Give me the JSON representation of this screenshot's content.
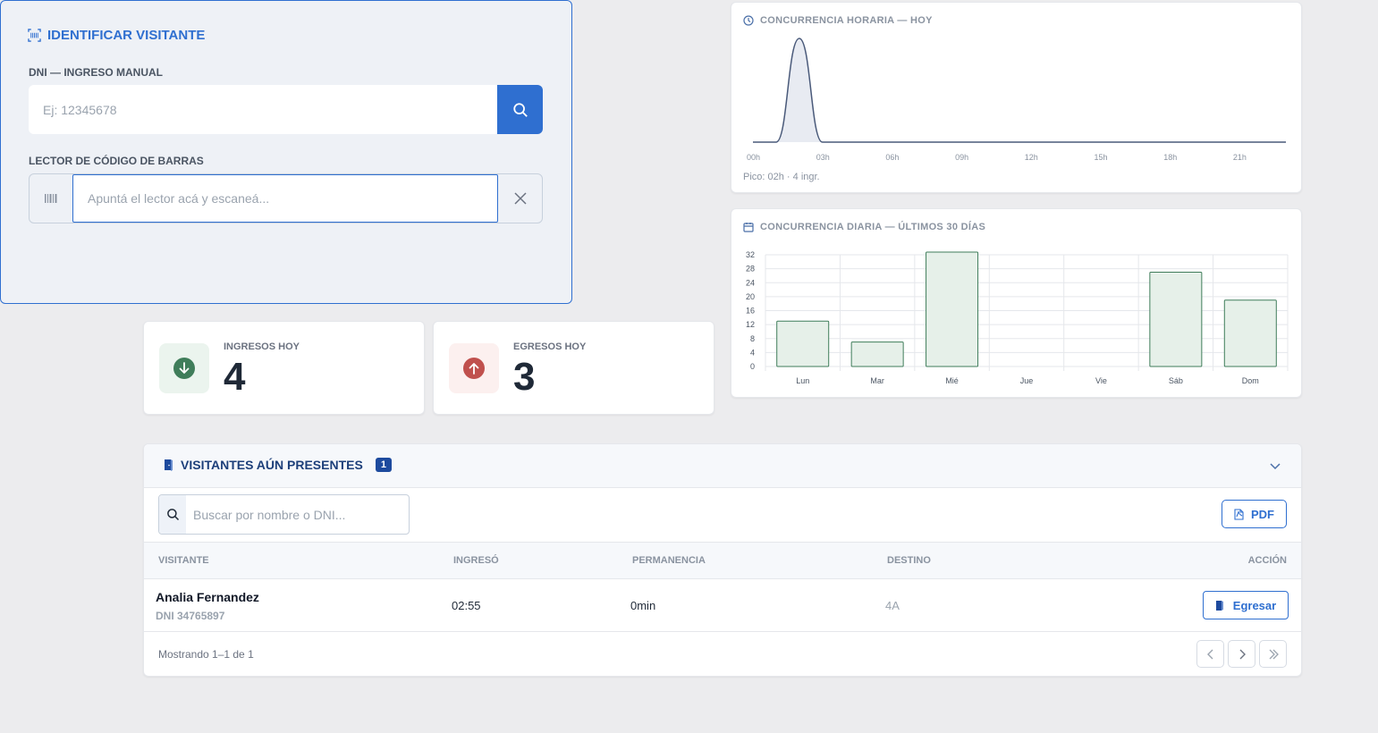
{
  "identify": {
    "title": "IDENTIFICAR VISITANTE",
    "dni_label": "DNI — INGRESO MANUAL",
    "dni_placeholder": "Ej: 12345678",
    "barcode_label": "LECTOR DE CÓDIGO DE BARRAS",
    "barcode_placeholder": "Apuntá el lector acá y escaneá..."
  },
  "stats": {
    "ingresos": {
      "label": "INGRESOS HOY",
      "value": "4",
      "color": "#3f7d5a",
      "bg": "#ebf4ee"
    },
    "egresos": {
      "label": "EGRESOS HOY",
      "value": "3",
      "color": "#c0504d",
      "bg": "#fcf0ef"
    }
  },
  "hourly_chart": {
    "title": "CONCURRENCIA HORARIA — HOY",
    "peak_text": "Pico: 02h · 4 ingr.",
    "chart_data": {
      "type": "area",
      "x_ticks": [
        "00h",
        "03h",
        "06h",
        "09h",
        "12h",
        "15h",
        "18h",
        "21h"
      ],
      "x": [
        0,
        1,
        2,
        3,
        4,
        5,
        6,
        7,
        8,
        9,
        10,
        11,
        12,
        13,
        14,
        15,
        16,
        17,
        18,
        19,
        20,
        21,
        22,
        23
      ],
      "values": [
        0,
        0,
        4,
        0,
        0,
        0,
        0,
        0,
        0,
        0,
        0,
        0,
        0,
        0,
        0,
        0,
        0,
        0,
        0,
        0,
        0,
        0,
        0,
        0
      ],
      "ylim": [
        0,
        4
      ],
      "color": "#4a5a7a",
      "grid": false
    }
  },
  "daily_chart": {
    "title": "CONCURRENCIA DIARIA — ÚLTIMOS 30 DÍAS",
    "chart_data": {
      "type": "bar",
      "categories": [
        "Lun",
        "Mar",
        "Mié",
        "Jue",
        "Vie",
        "Sáb",
        "Dom"
      ],
      "values": [
        13,
        7,
        33,
        0,
        0,
        27,
        19
      ],
      "ylim": [
        0,
        32
      ],
      "y_ticks": [
        0,
        4,
        8,
        12,
        16,
        20,
        24,
        28,
        32
      ],
      "bar_fill": "#e6f0e9",
      "bar_stroke": "#3f7d5a",
      "grid": true
    }
  },
  "visitors": {
    "title": "VISITANTES AÚN PRESENTES",
    "count": "1",
    "search_placeholder": "Buscar por nombre o DNI...",
    "pdf_label": "PDF",
    "columns": [
      "VISITANTE",
      "INGRESÓ",
      "PERMANENCIA",
      "DESTINO",
      "ACCIÓN"
    ],
    "rows": [
      {
        "name": "Analia Fernandez",
        "dni": "DNI 34765897",
        "ingreso": "02:55",
        "permanencia": "0min",
        "destino": "4A",
        "action": "Egresar"
      }
    ],
    "footer": "Mostrando 1–1 de 1"
  }
}
